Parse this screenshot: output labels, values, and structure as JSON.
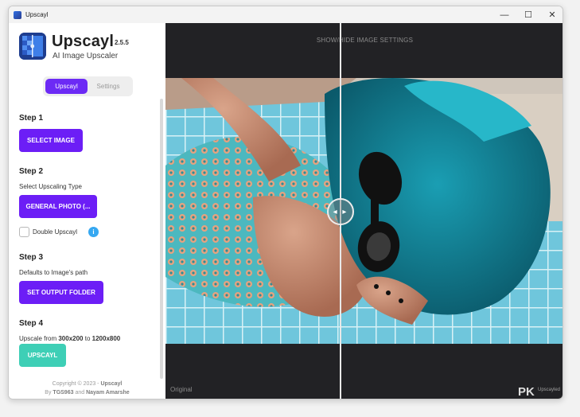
{
  "window": {
    "title": "Upscayl",
    "controls": {
      "minimize": "—",
      "maximize": "☐",
      "close": "✕"
    }
  },
  "sidebar": {
    "app_name": "Upscayl",
    "version": "2.5.5",
    "subtitle": "AI Image Upscaler",
    "tabs": [
      {
        "label": "Upscayl",
        "active": true
      },
      {
        "label": "Settings",
        "active": false
      }
    ],
    "step1": {
      "title": "Step 1",
      "button": "SELECT IMAGE"
    },
    "step2": {
      "title": "Step 2",
      "text": "Select Upscaling Type",
      "button": "GENERAL PHOTO (...",
      "double_upscale_label": "Double Upscayl",
      "double_upscale_checked": false,
      "info_icon": "i"
    },
    "step3": {
      "title": "Step 3",
      "text": "Defaults to Image's path",
      "button": "SET OUTPUT FOLDER"
    },
    "step4": {
      "title": "Step 4",
      "text_prefix": "Upscale from ",
      "from": "300x200",
      "text_mid": " to ",
      "to": "1200x800",
      "button": "UPSCAYL"
    },
    "footer": {
      "copyright_prefix": "Copyright © 2023 - ",
      "copyright_name": "Upscayl",
      "by_prefix": "By ",
      "author1": "TGS963",
      "and": " and ",
      "author2": "Nayam Amarshe"
    }
  },
  "viewer": {
    "settings_toggle": "SHOW/HIDE IMAGE SETTINGS",
    "original_label": "Original",
    "slider_handle_icon": "◂ ▸",
    "watermark": "PK",
    "watermark_small": "Upscayled"
  },
  "colors": {
    "accent": "#6c1ef6",
    "teal": "#3ecfb6",
    "viewer_bg": "#222225",
    "info": "#36a8f1"
  }
}
